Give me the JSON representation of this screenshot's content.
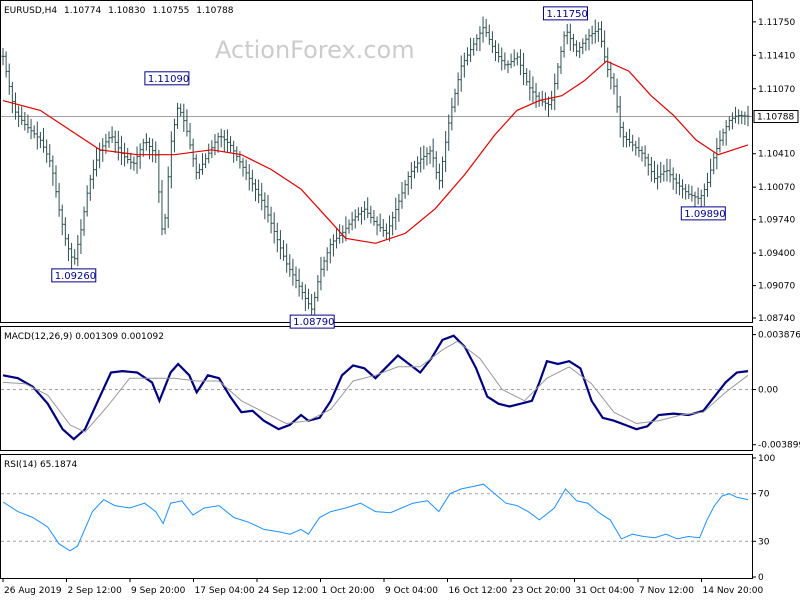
{
  "chart_data": [
    {
      "type": "candlestick",
      "title": "EURUSD,H4",
      "quote": {
        "open": "1.10774",
        "high": "1.10830",
        "low": "1.10755",
        "close": "1.10788"
      },
      "watermark": "ActionForex.com",
      "ylim": [
        1.0872,
        1.1183
      ],
      "y_ticks": [
        "1.11750",
        "1.11410",
        "1.11070",
        "1.10410",
        "1.10070",
        "1.09740",
        "1.09400",
        "1.09070",
        "1.08740"
      ],
      "current_price_label": "1.10788",
      "current_price": 1.10788,
      "x_tick_labels": [
        "26 Aug 2019",
        "2 Sep 12:00",
        "9 Sep 20:00",
        "17 Sep 04:00",
        "24 Sep 12:00",
        "1 Oct 20:00",
        "9 Oct 04:00",
        "16 Oct 12:00",
        "23 Oct 20:00",
        "31 Oct 04:00",
        "7 Nov 12:00",
        "14 Nov 20:00"
      ],
      "annotations": [
        {
          "label": "1.11090",
          "value": 1.1109,
          "bar": 0.22
        },
        {
          "label": "1.09260",
          "value": 1.0926,
          "bar": 0.095
        },
        {
          "label": "1.08790",
          "value": 1.0879,
          "bar": 0.415
        },
        {
          "label": "1.11750",
          "value": 1.1175,
          "bar": 0.755
        },
        {
          "label": "1.09890",
          "value": 1.0989,
          "bar": 0.94
        }
      ],
      "price_path": [
        [
          0.0,
          1.114
        ],
        [
          0.015,
          1.1085
        ],
        [
          0.03,
          1.107
        ],
        [
          0.05,
          1.1055
        ],
        [
          0.065,
          1.103
        ],
        [
          0.075,
          1.0985
        ],
        [
          0.085,
          1.095
        ],
        [
          0.095,
          1.093
        ],
        [
          0.105,
          1.0965
        ],
        [
          0.115,
          1.101
        ],
        [
          0.13,
          1.1045
        ],
        [
          0.145,
          1.106
        ],
        [
          0.16,
          1.104
        ],
        [
          0.175,
          1.103
        ],
        [
          0.19,
          1.1055
        ],
        [
          0.205,
          1.104
        ],
        [
          0.215,
          1.095
        ],
        [
          0.225,
          1.105
        ],
        [
          0.235,
          1.109
        ],
        [
          0.245,
          1.107
        ],
        [
          0.26,
          1.102
        ],
        [
          0.275,
          1.104
        ],
        [
          0.29,
          1.106
        ],
        [
          0.305,
          1.105
        ],
        [
          0.32,
          1.103
        ],
        [
          0.335,
          1.101
        ],
        [
          0.35,
          1.099
        ],
        [
          0.365,
          1.096
        ],
        [
          0.38,
          1.093
        ],
        [
          0.395,
          1.091
        ],
        [
          0.405,
          1.0895
        ],
        [
          0.415,
          1.0882
        ],
        [
          0.425,
          1.092
        ],
        [
          0.44,
          1.095
        ],
        [
          0.455,
          1.096
        ],
        [
          0.47,
          1.0975
        ],
        [
          0.485,
          1.0985
        ],
        [
          0.5,
          1.097
        ],
        [
          0.515,
          1.096
        ],
        [
          0.53,
          1.099
        ],
        [
          0.545,
          1.102
        ],
        [
          0.56,
          1.1035
        ],
        [
          0.575,
          1.1045
        ],
        [
          0.585,
          1.101
        ],
        [
          0.6,
          1.108
        ],
        [
          0.615,
          1.113
        ],
        [
          0.63,
          1.115
        ],
        [
          0.645,
          1.117
        ],
        [
          0.66,
          1.1145
        ],
        [
          0.675,
          1.113
        ],
        [
          0.69,
          1.114
        ],
        [
          0.705,
          1.111
        ],
        [
          0.72,
          1.1095
        ],
        [
          0.735,
          1.109
        ],
        [
          0.745,
          1.113
        ],
        [
          0.755,
          1.1168
        ],
        [
          0.77,
          1.1145
        ],
        [
          0.785,
          1.116
        ],
        [
          0.8,
          1.1168
        ],
        [
          0.81,
          1.113
        ],
        [
          0.82,
          1.111
        ],
        [
          0.83,
          1.106
        ],
        [
          0.845,
          1.105
        ],
        [
          0.86,
          1.104
        ],
        [
          0.875,
          1.1015
        ],
        [
          0.89,
          1.1025
        ],
        [
          0.905,
          1.101
        ],
        [
          0.92,
          1.1
        ],
        [
          0.935,
          1.0995
        ],
        [
          0.945,
          1.101
        ],
        [
          0.955,
          1.104
        ],
        [
          0.965,
          1.106
        ],
        [
          0.975,
          1.1075
        ],
        [
          0.985,
          1.108
        ],
        [
          1.0,
          1.1079
        ]
      ],
      "ma_path": [
        [
          0.0,
          1.1095
        ],
        [
          0.05,
          1.1085
        ],
        [
          0.1,
          1.106
        ],
        [
          0.13,
          1.1045
        ],
        [
          0.18,
          1.104
        ],
        [
          0.23,
          1.104
        ],
        [
          0.28,
          1.1045
        ],
        [
          0.32,
          1.104
        ],
        [
          0.36,
          1.1025
        ],
        [
          0.4,
          1.1005
        ],
        [
          0.43,
          1.098
        ],
        [
          0.46,
          1.0955
        ],
        [
          0.5,
          1.095
        ],
        [
          0.54,
          1.096
        ],
        [
          0.58,
          1.0985
        ],
        [
          0.62,
          1.102
        ],
        [
          0.66,
          1.106
        ],
        [
          0.69,
          1.1085
        ],
        [
          0.72,
          1.1095
        ],
        [
          0.75,
          1.11
        ],
        [
          0.78,
          1.1115
        ],
        [
          0.81,
          1.1135
        ],
        [
          0.84,
          1.1125
        ],
        [
          0.87,
          1.11
        ],
        [
          0.9,
          1.108
        ],
        [
          0.93,
          1.1055
        ],
        [
          0.96,
          1.104
        ],
        [
          0.98,
          1.1045
        ],
        [
          1.0,
          1.105
        ]
      ],
      "ma_color": "#e00000",
      "bar_color": "#2f4f4f"
    },
    {
      "type": "line",
      "title": "MACD(12,26,9) 0.001309 0.001092",
      "ylim": [
        -0.0042,
        0.0042
      ],
      "y_ticks": [
        "0.003876",
        "0.00",
        "-0.003899"
      ],
      "zero_line": 0.0,
      "series": [
        {
          "color": "#000080",
          "points": [
            [
              0.0,
              0.001
            ],
            [
              0.02,
              0.0008
            ],
            [
              0.04,
              0.0002
            ],
            [
              0.06,
              -0.001
            ],
            [
              0.08,
              -0.0028
            ],
            [
              0.095,
              -0.0035
            ],
            [
              0.11,
              -0.0028
            ],
            [
              0.13,
              -0.0005
            ],
            [
              0.145,
              0.0012
            ],
            [
              0.16,
              0.0013
            ],
            [
              0.18,
              0.0012
            ],
            [
              0.2,
              0.0005
            ],
            [
              0.21,
              -0.0008
            ],
            [
              0.225,
              0.0012
            ],
            [
              0.235,
              0.0018
            ],
            [
              0.25,
              0.001
            ],
            [
              0.26,
              -0.0002
            ],
            [
              0.275,
              0.001
            ],
            [
              0.29,
              0.0008
            ],
            [
              0.305,
              -0.0005
            ],
            [
              0.32,
              -0.0016
            ],
            [
              0.335,
              -0.0015
            ],
            [
              0.35,
              -0.0022
            ],
            [
              0.37,
              -0.0028
            ],
            [
              0.385,
              -0.0025
            ],
            [
              0.4,
              -0.0018
            ],
            [
              0.41,
              -0.0022
            ],
            [
              0.425,
              -0.002
            ],
            [
              0.44,
              -0.0008
            ],
            [
              0.455,
              0.001
            ],
            [
              0.47,
              0.0017
            ],
            [
              0.485,
              0.0015
            ],
            [
              0.5,
              0.0008
            ],
            [
              0.515,
              0.0016
            ],
            [
              0.53,
              0.0024
            ],
            [
              0.545,
              0.0018
            ],
            [
              0.56,
              0.0012
            ],
            [
              0.575,
              0.0022
            ],
            [
              0.59,
              0.0035
            ],
            [
              0.605,
              0.0038
            ],
            [
              0.62,
              0.003
            ],
            [
              0.635,
              0.0015
            ],
            [
              0.65,
              -0.0005
            ],
            [
              0.665,
              -0.001
            ],
            [
              0.68,
              -0.0012
            ],
            [
              0.695,
              -0.001
            ],
            [
              0.71,
              -0.0008
            ],
            [
              0.72,
              0.0005
            ],
            [
              0.73,
              0.002
            ],
            [
              0.745,
              0.0018
            ],
            [
              0.76,
              0.002
            ],
            [
              0.775,
              0.0015
            ],
            [
              0.79,
              -0.0008
            ],
            [
              0.805,
              -0.002
            ],
            [
              0.82,
              -0.0022
            ],
            [
              0.835,
              -0.0025
            ],
            [
              0.85,
              -0.0028
            ],
            [
              0.865,
              -0.0026
            ],
            [
              0.88,
              -0.0018
            ],
            [
              0.9,
              -0.0017
            ],
            [
              0.92,
              -0.0018
            ],
            [
              0.94,
              -0.0015
            ],
            [
              0.955,
              -0.0005
            ],
            [
              0.97,
              0.0005
            ],
            [
              0.985,
              0.0012
            ],
            [
              1.0,
              0.0013
            ]
          ]
        },
        {
          "color": "#999999",
          "points": [
            [
              0.0,
              0.0005
            ],
            [
              0.03,
              0.0004
            ],
            [
              0.06,
              -0.0004
            ],
            [
              0.09,
              -0.0025
            ],
            [
              0.11,
              -0.003
            ],
            [
              0.14,
              -0.0012
            ],
            [
              0.17,
              0.0008
            ],
            [
              0.2,
              0.0008
            ],
            [
              0.23,
              0.0008
            ],
            [
              0.26,
              0.0006
            ],
            [
              0.29,
              0.0006
            ],
            [
              0.32,
              -0.0008
            ],
            [
              0.35,
              -0.0016
            ],
            [
              0.38,
              -0.0024
            ],
            [
              0.41,
              -0.0022
            ],
            [
              0.44,
              -0.0014
            ],
            [
              0.47,
              0.0006
            ],
            [
              0.5,
              0.001
            ],
            [
              0.53,
              0.0016
            ],
            [
              0.56,
              0.0016
            ],
            [
              0.59,
              0.0028
            ],
            [
              0.61,
              0.0034
            ],
            [
              0.64,
              0.0022
            ],
            [
              0.67,
              0.0
            ],
            [
              0.7,
              -0.0008
            ],
            [
              0.73,
              0.0008
            ],
            [
              0.76,
              0.0016
            ],
            [
              0.79,
              0.0004
            ],
            [
              0.82,
              -0.0016
            ],
            [
              0.85,
              -0.0024
            ],
            [
              0.88,
              -0.0022
            ],
            [
              0.91,
              -0.0018
            ],
            [
              0.94,
              -0.0016
            ],
            [
              0.97,
              -0.0002
            ],
            [
              1.0,
              0.001
            ]
          ]
        }
      ]
    },
    {
      "type": "line",
      "title": "RSI(14) 65.1874",
      "ylim": [
        0,
        100
      ],
      "y_ticks": [
        "100",
        "70",
        "30",
        "0"
      ],
      "levels": [
        70,
        30
      ],
      "series": [
        {
          "color": "#1e90ff",
          "points": [
            [
              0.0,
              63
            ],
            [
              0.02,
              55
            ],
            [
              0.04,
              50
            ],
            [
              0.06,
              42
            ],
            [
              0.075,
              28
            ],
            [
              0.09,
              22
            ],
            [
              0.1,
              26
            ],
            [
              0.12,
              55
            ],
            [
              0.135,
              65
            ],
            [
              0.15,
              60
            ],
            [
              0.17,
              58
            ],
            [
              0.19,
              62
            ],
            [
              0.205,
              55
            ],
            [
              0.215,
              45
            ],
            [
              0.225,
              62
            ],
            [
              0.24,
              64
            ],
            [
              0.255,
              52
            ],
            [
              0.27,
              58
            ],
            [
              0.29,
              60
            ],
            [
              0.31,
              50
            ],
            [
              0.33,
              46
            ],
            [
              0.35,
              40
            ],
            [
              0.37,
              38
            ],
            [
              0.385,
              36
            ],
            [
              0.4,
              40
            ],
            [
              0.41,
              36
            ],
            [
              0.425,
              50
            ],
            [
              0.44,
              55
            ],
            [
              0.46,
              58
            ],
            [
              0.48,
              62
            ],
            [
              0.5,
              55
            ],
            [
              0.52,
              54
            ],
            [
              0.535,
              58
            ],
            [
              0.55,
              62
            ],
            [
              0.57,
              64
            ],
            [
              0.585,
              55
            ],
            [
              0.6,
              70
            ],
            [
              0.615,
              74
            ],
            [
              0.63,
              76
            ],
            [
              0.645,
              78
            ],
            [
              0.66,
              70
            ],
            [
              0.675,
              62
            ],
            [
              0.69,
              60
            ],
            [
              0.705,
              55
            ],
            [
              0.72,
              48
            ],
            [
              0.74,
              58
            ],
            [
              0.755,
              74
            ],
            [
              0.77,
              64
            ],
            [
              0.785,
              62
            ],
            [
              0.8,
              54
            ],
            [
              0.815,
              48
            ],
            [
              0.83,
              32
            ],
            [
              0.845,
              36
            ],
            [
              0.86,
              34
            ],
            [
              0.875,
              33
            ],
            [
              0.89,
              36
            ],
            [
              0.905,
              32
            ],
            [
              0.92,
              34
            ],
            [
              0.935,
              33
            ],
            [
              0.945,
              48
            ],
            [
              0.955,
              60
            ],
            [
              0.965,
              68
            ],
            [
              0.975,
              70
            ],
            [
              0.985,
              67
            ],
            [
              1.0,
              65
            ]
          ]
        }
      ]
    }
  ]
}
